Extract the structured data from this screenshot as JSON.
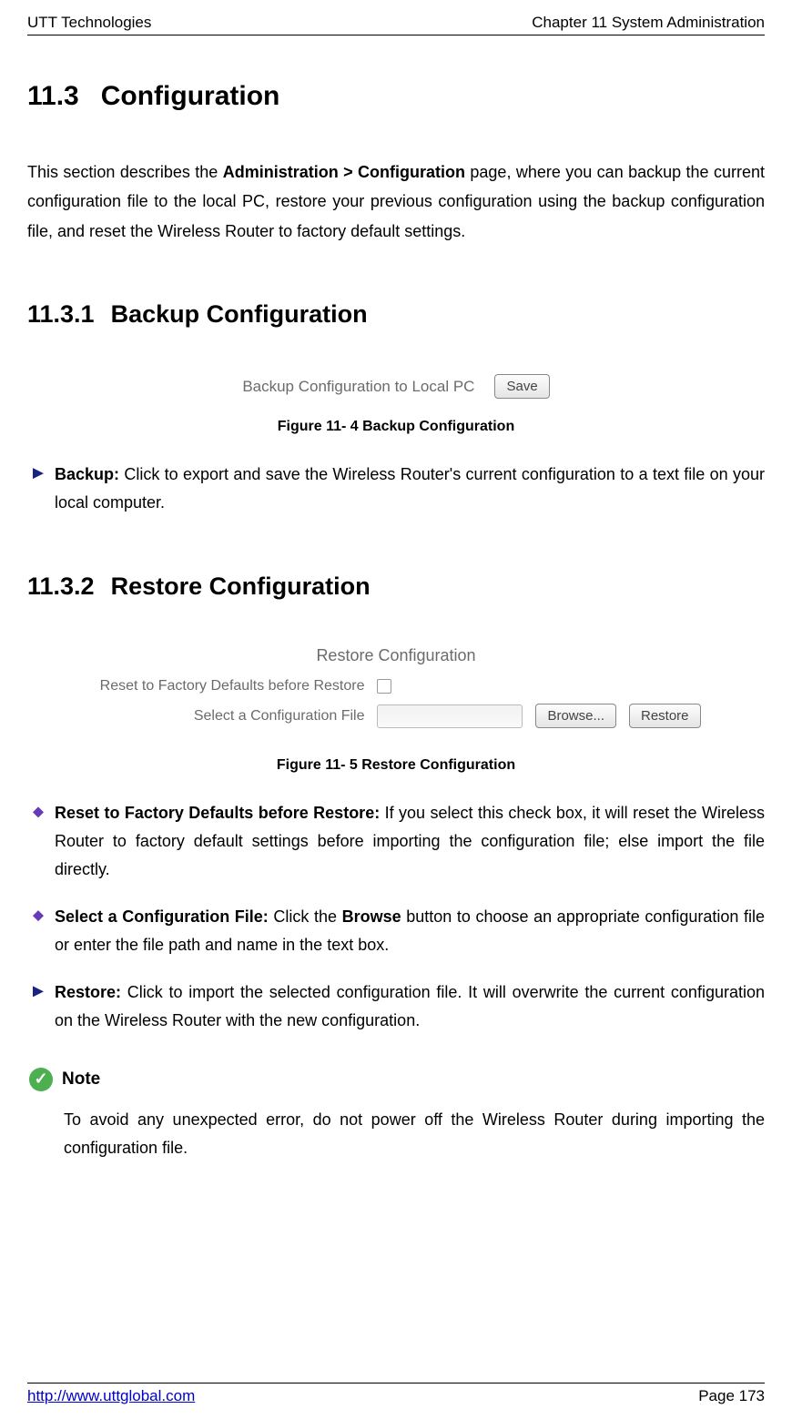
{
  "header": {
    "left": "UTT Technologies",
    "right": "Chapter 11 System Administration"
  },
  "section": {
    "number": "11.3",
    "title": "Configuration"
  },
  "intro": {
    "t1": "This section describes the ",
    "bold1": "Administration > Configuration",
    "t2": " page, where you can backup the current configuration file to the local PC, restore your previous configuration using the backup configuration file, and reset the Wireless Router to factory default settings."
  },
  "sub1": {
    "number": "11.3.1",
    "title": "Backup Configuration"
  },
  "fig4": {
    "label": "Backup Configuration to Local PC",
    "btn": "Save",
    "caption": "Figure 11- 4 Backup Configuration"
  },
  "sub1_bullet": {
    "bold": "Backup:",
    "text": " Click to export and save the Wireless Router's current configuration to a text file on your local computer."
  },
  "sub2": {
    "number": "11.3.2",
    "title": "Restore Configuration"
  },
  "fig5": {
    "title": "Restore Configuration",
    "row1_label": "Reset to Factory Defaults before Restore",
    "row2_label": "Select a Configuration File",
    "browse": "Browse...",
    "restore": "Restore",
    "caption": "Figure 11- 5 Restore Configuration"
  },
  "sub2_bullets": [
    {
      "bold": "Reset to Factory Defaults before Restore:",
      "text": " If you select this check box, it will reset the Wireless Router to factory default settings before importing the configuration file; else import the file directly."
    },
    {
      "bold": "Select a Configuration File:",
      "t1": " Click the ",
      "boldmid": "Browse",
      "t2": " button to choose an appropriate configuration file or enter the file path and name in the text box."
    },
    {
      "bold": "Restore:",
      "text": " Click to import the selected configuration file. It will overwrite the current configuration on the Wireless Router with the new configuration."
    }
  ],
  "note": {
    "label": "Note",
    "text": "To avoid any unexpected error, do not power off the Wireless Router during importing the configuration file."
  },
  "footer": {
    "link": "http://www.uttglobal.com",
    "page": "Page 173"
  }
}
